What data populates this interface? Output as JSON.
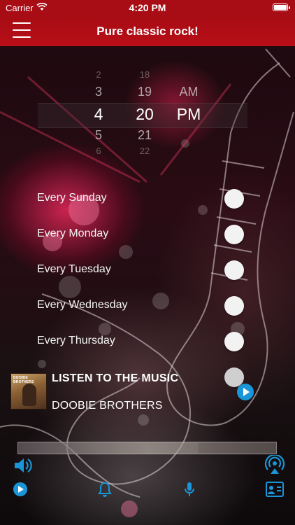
{
  "status_bar": {
    "carrier": "Carrier",
    "time": "4:20 PM",
    "wifi_icon": "wifi-icon",
    "battery_icon": "battery-icon"
  },
  "nav": {
    "title": "Pure classic rock!",
    "menu_icon": "hamburger-menu-icon"
  },
  "time_picker": {
    "hour": [
      "2",
      "3",
      "4",
      "5",
      "6"
    ],
    "minute": [
      "18",
      "19",
      "20",
      "21",
      "22"
    ],
    "ampm": [
      "",
      "AM",
      "PM",
      "",
      ""
    ],
    "selected": {
      "hour": "4",
      "minute": "20",
      "ampm": "PM"
    }
  },
  "days": [
    {
      "label": "Every Sunday",
      "on": false
    },
    {
      "label": "Every Monday",
      "on": false
    },
    {
      "label": "Every Tuesday",
      "on": false
    },
    {
      "label": "Every Wednesday",
      "on": false
    },
    {
      "label": "Every Thursday",
      "on": false
    }
  ],
  "now_playing": {
    "title": "LISTEN TO THE MUSIC",
    "artist": "DOOBIE BROTHERS",
    "album_text": "DOOBIE BROTHERS"
  },
  "toolbar": {
    "volume_icon": "volume-icon",
    "airplay_icon": "airplay-icon",
    "play_icon": "play-icon",
    "alarm_icon": "bell-icon",
    "mic_icon": "microphone-icon",
    "contact_icon": "contact-card-icon"
  },
  "colors": {
    "accent_red": "#b80e18",
    "accent_blue": "#1a96d8"
  }
}
